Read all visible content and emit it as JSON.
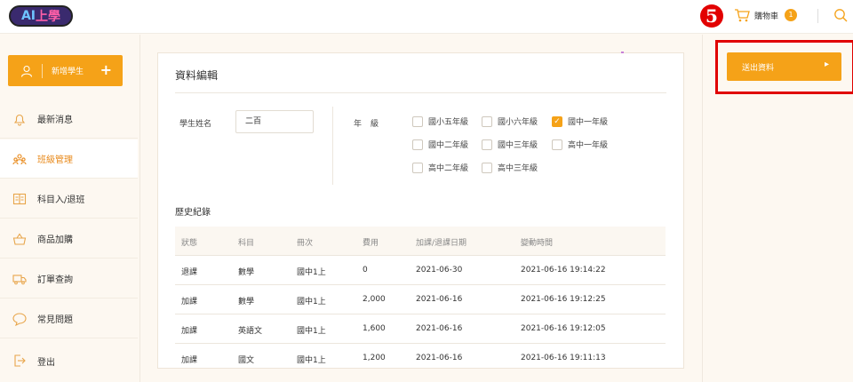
{
  "header": {
    "logo_text_ai": "AI",
    "logo_text_up": "上學",
    "marker": "5",
    "cart_label": "購物車",
    "cart_count": "1"
  },
  "sidebar": {
    "add_student": "新增學生",
    "add_plus": "+",
    "items": [
      {
        "label": "最新消息",
        "icon": "bell-icon",
        "active": false
      },
      {
        "label": "班級管理",
        "icon": "people-icon",
        "active": true
      },
      {
        "label": "科目入/退班",
        "icon": "book-icon",
        "active": false
      },
      {
        "label": "商品加購",
        "icon": "basket-icon",
        "active": false
      },
      {
        "label": "訂單查詢",
        "icon": "truck-icon",
        "active": false
      },
      {
        "label": "常見問題",
        "icon": "chat-icon",
        "active": false
      },
      {
        "label": "登出",
        "icon": "logout-icon",
        "active": false
      }
    ]
  },
  "form": {
    "title": "資料編輯",
    "name_label": "學生姓名",
    "name_value": "二百",
    "grade_label": "年級",
    "grades": [
      {
        "label": "國小五年級",
        "checked": false
      },
      {
        "label": "國小六年級",
        "checked": false
      },
      {
        "label": "國中一年級",
        "checked": true
      },
      {
        "label": "國中二年級",
        "checked": false
      },
      {
        "label": "國中三年級",
        "checked": false
      },
      {
        "label": "高中一年級",
        "checked": false
      },
      {
        "label": "高中二年級",
        "checked": false
      },
      {
        "label": "高中三年級",
        "checked": false
      }
    ]
  },
  "history": {
    "title": "歷史紀錄",
    "columns": [
      "狀態",
      "科目",
      "冊次",
      "費用",
      "加課/退課日期",
      "變動時間"
    ],
    "rows": [
      [
        "退課",
        "數學",
        "國中1上",
        "0",
        "2021-06-30",
        "2021-06-16 19:14:22"
      ],
      [
        "加課",
        "數學",
        "國中1上",
        "2,000",
        "2021-06-16",
        "2021-06-16 19:12:25"
      ],
      [
        "加課",
        "英語文",
        "國中1上",
        "1,600",
        "2021-06-16",
        "2021-06-16 19:12:05"
      ],
      [
        "加課",
        "國文",
        "國中1上",
        "1,200",
        "2021-06-16",
        "2021-06-16 19:11:13"
      ]
    ]
  },
  "right": {
    "submit_label": "送出資料",
    "submit_arrow": "▸"
  },
  "colors": {
    "accent": "#f5a218",
    "highlight": "#e00000",
    "marker": "#e20000"
  }
}
